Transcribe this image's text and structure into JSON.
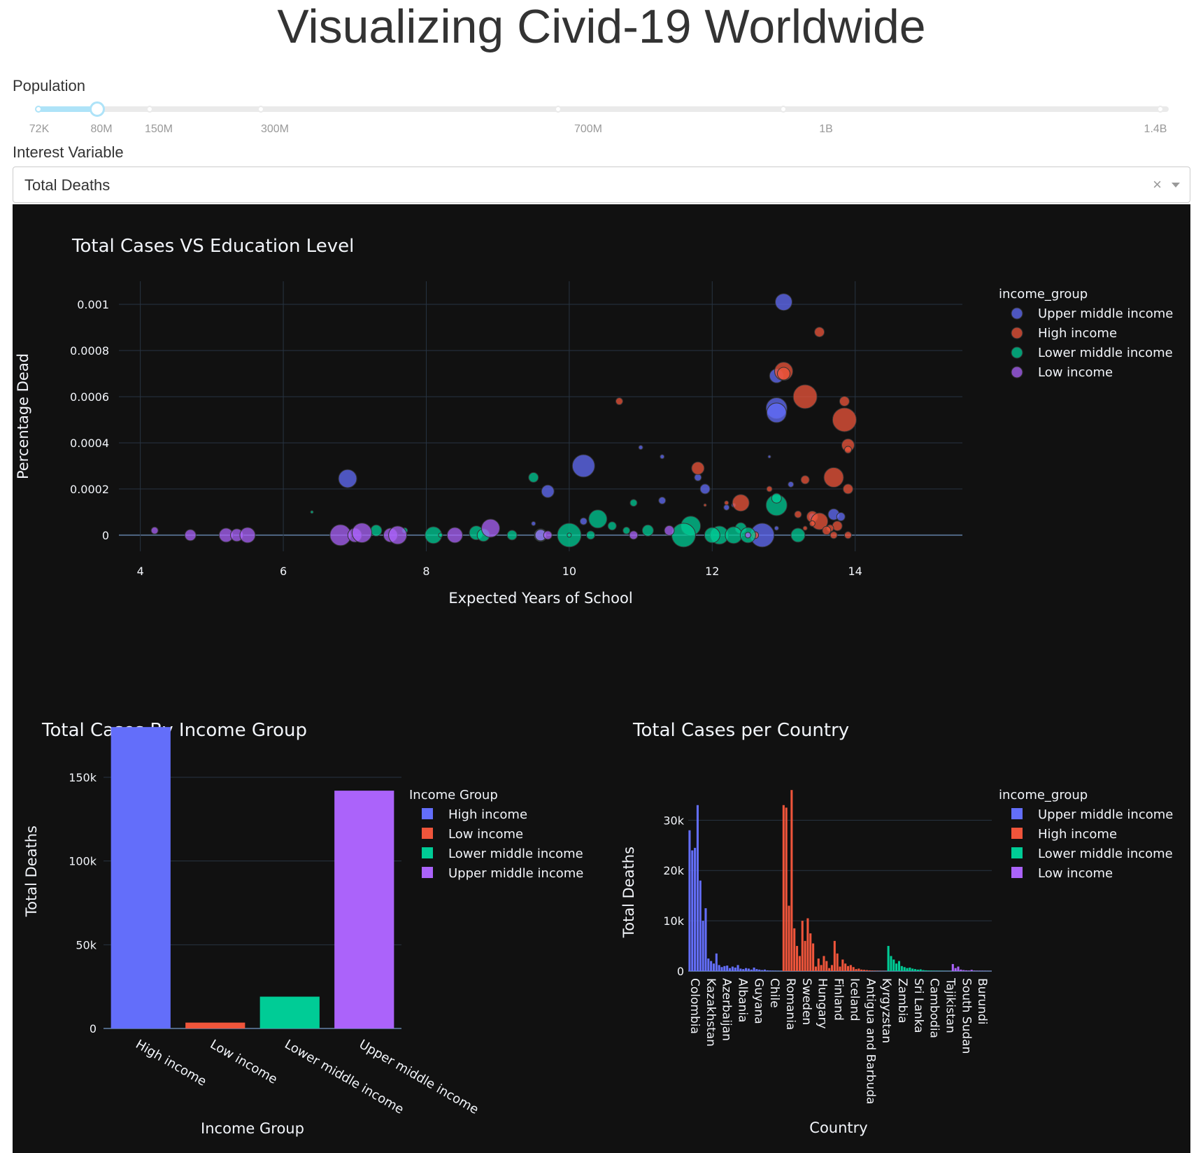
{
  "page": {
    "title": "Visualizing Civid-19 Worldwide"
  },
  "population": {
    "label": "Population",
    "marks": [
      "72K",
      "80M",
      "150M",
      "300M",
      "700M",
      "1B",
      "1.4B"
    ],
    "selected": "80M"
  },
  "interest_variable": {
    "label": "Interest Variable",
    "value": "Total Deaths",
    "clear_glyph": "×"
  },
  "colors": {
    "upper_middle": "#636efa",
    "high": "#ef553b",
    "lower_middle": "#00cc96",
    "low": "#ab63fa",
    "slider_active": "#aee3f8",
    "panel_bg": "#111111"
  },
  "chart_data": [
    {
      "type": "scatter",
      "title": "Total Cases VS Education Level",
      "xlabel": "Expected Years of School",
      "ylabel": "Percentage Dead",
      "xlim": [
        3.7,
        15.5
      ],
      "ylim": [
        -7e-05,
        0.0011
      ],
      "x_ticks": [
        4,
        6,
        8,
        10,
        12,
        14
      ],
      "y_ticks": [
        0,
        0.0002,
        0.0004,
        0.0006,
        0.0008,
        0.001
      ],
      "y_tick_labels": [
        "0",
        "0.0002",
        "0.0004",
        "0.0006",
        "0.0008",
        "0.001"
      ],
      "legend_title": "income_group",
      "series": [
        {
          "name": "Upper middle income",
          "color": "#636efa",
          "points": [
            [
              13.0,
              0.00101,
              12
            ],
            [
              12.9,
              0.00069,
              10
            ],
            [
              12.9,
              0.00055,
              15
            ],
            [
              12.9,
              0.00053,
              14
            ],
            [
              10.2,
              0.0003,
              16
            ],
            [
              6.9,
              0.000245,
              13
            ],
            [
              9.7,
              0.00019,
              9
            ],
            [
              11.8,
              0.00025,
              5
            ],
            [
              11.9,
              0.0002,
              7
            ],
            [
              12.2,
              0.00012,
              4
            ],
            [
              11.3,
              0.00015,
              5
            ],
            [
              11.0,
              0.00038,
              3
            ],
            [
              11.3,
              0.00034,
              3
            ],
            [
              12.8,
              0.00034,
              2
            ],
            [
              13.1,
              0.00022,
              4
            ],
            [
              12.7,
              0.0,
              17
            ],
            [
              13.7,
              9e-05,
              8
            ],
            [
              13.8,
              8e-05,
              6
            ],
            [
              12.9,
              3e-05,
              3
            ],
            [
              10.2,
              6e-05,
              5
            ],
            [
              9.5,
              5e-05,
              3
            ],
            [
              12.3,
              0.00013,
              3
            ],
            [
              13.4,
              8e-05,
              5
            ]
          ]
        },
        {
          "name": "High income",
          "color": "#ef553b",
          "points": [
            [
              13.5,
              0.00088,
              7
            ],
            [
              13.0,
              0.00071,
              13
            ],
            [
              13.0,
              0.0007,
              9
            ],
            [
              13.3,
              0.0006,
              17
            ],
            [
              13.85,
              0.0005,
              17
            ],
            [
              13.85,
              0.00058,
              7
            ],
            [
              13.9,
              0.00039,
              9
            ],
            [
              13.9,
              0.00037,
              5
            ],
            [
              10.7,
              0.00058,
              5
            ],
            [
              11.8,
              0.00029,
              9
            ],
            [
              12.4,
              0.00014,
              12
            ],
            [
              13.7,
              0.00025,
              14
            ],
            [
              13.3,
              0.00024,
              6
            ],
            [
              13.9,
              0.0002,
              7
            ],
            [
              12.8,
              0.0002,
              4
            ],
            [
              13.4,
              8e-05,
              8
            ],
            [
              13.5,
              6e-05,
              12
            ],
            [
              13.75,
              4e-05,
              7
            ],
            [
              13.65,
              3e-05,
              5
            ],
            [
              13.6,
              2e-05,
              6
            ],
            [
              13.2,
              9e-05,
              5
            ],
            [
              13.4,
              5e-05,
              4
            ],
            [
              13.9,
              0.0,
              5
            ],
            [
              13.7,
              0.0,
              5
            ],
            [
              13.3,
              3e-05,
              3
            ],
            [
              12.6,
              0.0,
              5
            ],
            [
              12.2,
              0.00014,
              3
            ],
            [
              11.9,
              0.00013,
              2
            ]
          ]
        },
        {
          "name": "Lower middle income",
          "color": "#00cc96",
          "points": [
            [
              12.9,
              0.00013,
              15
            ],
            [
              12.9,
              0.00016,
              7
            ],
            [
              12.4,
              3e-05,
              8
            ],
            [
              11.7,
              4e-05,
              14
            ],
            [
              11.6,
              0.0,
              17
            ],
            [
              10.4,
              7e-05,
              13
            ],
            [
              10.0,
              0.0,
              17
            ],
            [
              9.5,
              0.00025,
              7
            ],
            [
              10.6,
              4e-05,
              6
            ],
            [
              10.9,
              0.00014,
              5
            ],
            [
              10.8,
              2e-05,
              5
            ],
            [
              11.1,
              2e-05,
              8
            ],
            [
              12.1,
              0.0,
              13
            ],
            [
              12.3,
              0.0,
              12
            ],
            [
              12.5,
              0.0,
              11
            ],
            [
              12.0,
              0.0,
              11
            ],
            [
              13.2,
              0.0,
              10
            ],
            [
              10.3,
              0.0,
              6
            ],
            [
              9.2,
              0.0,
              7
            ],
            [
              8.7,
              1e-05,
              10
            ],
            [
              8.1,
              0.0,
              12
            ],
            [
              7.3,
              2e-05,
              8
            ],
            [
              7.7,
              2e-05,
              4
            ],
            [
              6.4,
              0.0001,
              2
            ],
            [
              8.2,
              0.0,
              3
            ],
            [
              8.8,
              0.0,
              9
            ],
            [
              9.6,
              0.0,
              9
            ],
            [
              10.0,
              0.0,
              3
            ]
          ]
        },
        {
          "name": "Low income",
          "color": "#ab63fa",
          "points": [
            [
              4.2,
              2e-05,
              5
            ],
            [
              4.7,
              0.0,
              8
            ],
            [
              5.2,
              0.0,
              10
            ],
            [
              5.35,
              0.0,
              9
            ],
            [
              5.5,
              0.0,
              11
            ],
            [
              6.8,
              0.0,
              15
            ],
            [
              7.0,
              0.0,
              10
            ],
            [
              7.1,
              1e-05,
              14
            ],
            [
              7.5,
              0.0,
              10
            ],
            [
              7.6,
              0.0,
              13
            ],
            [
              8.4,
              0.0,
              11
            ],
            [
              8.9,
              3e-05,
              13
            ],
            [
              9.6,
              0.0,
              8
            ],
            [
              9.7,
              0.0,
              6
            ],
            [
              10.9,
              0.0,
              6
            ],
            [
              11.4,
              2e-05,
              7
            ],
            [
              12.5,
              0.0,
              4
            ]
          ]
        }
      ]
    },
    {
      "type": "bar",
      "title": "Total Cases By Income Group",
      "xlabel": "Income Group",
      "ylabel": "Total Deaths",
      "ylim": [
        0,
        188000
      ],
      "y_ticks": [
        0,
        50000,
        100000,
        150000
      ],
      "y_tick_labels": [
        "0",
        "50k",
        "100k",
        "150k"
      ],
      "legend_title": "Income Group",
      "categories": [
        "High income",
        "Low income",
        "Lower middle income",
        "Upper middle income"
      ],
      "values": [
        180000,
        3500,
        19000,
        142000
      ],
      "colors": [
        "#636efa",
        "#ef553b",
        "#00cc96",
        "#ab63fa"
      ]
    },
    {
      "type": "bar",
      "title": "Total Cases per Country",
      "xlabel": "Country",
      "ylabel": "Total Deaths",
      "ylim": [
        0,
        37000
      ],
      "y_ticks": [
        0,
        10000,
        20000,
        30000
      ],
      "y_tick_labels": [
        "0",
        "10k",
        "20k",
        "30k"
      ],
      "legend_title": "income_group",
      "legend": [
        "Upper middle income",
        "High income",
        "Lower middle income",
        "Low income"
      ],
      "tick_labels": [
        "Colombia",
        "Kazakhstan",
        "Azerbaijan",
        "Albania",
        "Guyana",
        "Chile",
        "Romania",
        "Sweden",
        "Hungary",
        "Finland",
        "Iceland",
        "Antigua and Barbuda",
        "Kyrgyzstan",
        "Zambia",
        "Sri Lanka",
        "Cambodia",
        "Tajikistan",
        "South Sudan",
        "Burundi"
      ],
      "series": [
        {
          "name": "Upper middle income",
          "color": "#636efa",
          "values": [
            28000,
            24000,
            24500,
            33000,
            18000,
            10000,
            12500,
            2500,
            2000,
            1500,
            3500,
            1200,
            800,
            1000,
            1100,
            600,
            900,
            700,
            1200,
            500,
            400,
            600,
            500,
            300,
            700,
            400,
            300,
            200,
            300,
            150,
            100,
            80,
            60,
            40,
            30
          ]
        },
        {
          "name": "High income",
          "color": "#ef553b",
          "values": [
            33000,
            32500,
            13000,
            36000,
            8500,
            5000,
            3000,
            10000,
            6000,
            10500,
            7500,
            5500,
            900,
            2500,
            1200,
            3000,
            2000,
            600,
            1200,
            6000,
            3500,
            900,
            2300,
            1500,
            1000,
            1200,
            800,
            400,
            500,
            300,
            250,
            200,
            150,
            100,
            80,
            60,
            40,
            30,
            20
          ]
        },
        {
          "name": "Lower middle income",
          "color": "#00cc96",
          "values": [
            5000,
            3000,
            2300,
            1500,
            2000,
            1000,
            800,
            600,
            700,
            500,
            400,
            300,
            350,
            200,
            150,
            100,
            80,
            60,
            50,
            40,
            30,
            20,
            15,
            10
          ]
        },
        {
          "name": "Low income",
          "color": "#ab63fa",
          "values": [
            1400,
            600,
            900,
            300,
            200,
            150,
            100,
            250,
            80,
            60,
            50,
            40,
            30,
            20,
            15
          ]
        }
      ]
    }
  ]
}
